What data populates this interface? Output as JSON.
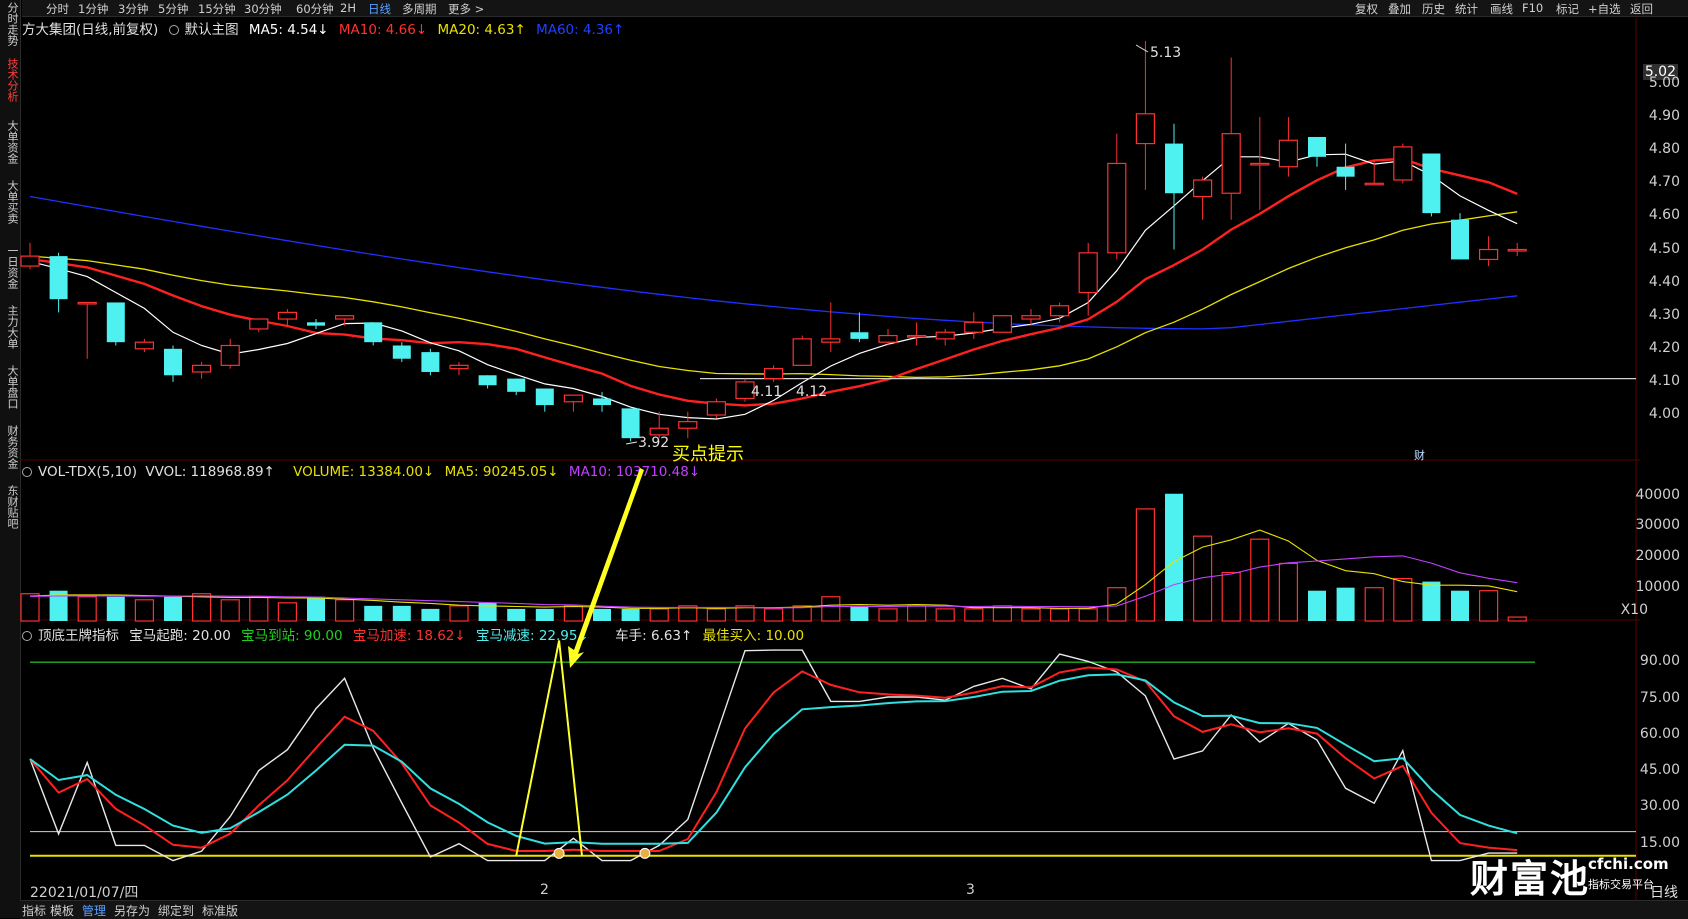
{
  "left_tabs": [
    "分时走势",
    "技术分析",
    "大单资金",
    "大单买卖",
    "一日资金",
    "主力大单",
    "大单盘口",
    "财务资金",
    "东财贴吧"
  ],
  "top_timeframes": [
    "分时",
    "1分钟",
    "3分钟",
    "5分钟",
    "15分钟",
    "30分钟",
    "60分钟",
    "2H",
    "日线",
    "多周期",
    "更多 >"
  ],
  "top_right": [
    "复权",
    "叠加",
    "历史",
    "统计",
    "画线",
    "F10",
    "标记",
    "+自选",
    "返回"
  ],
  "main_header": {
    "title": "方大集团(日线,前复权)",
    "chart_label": "默认主图",
    "ma5": "MA5: 4.54↓",
    "ma10": "MA10: 4.66↓",
    "ma20": "MA20: 4.63↑",
    "ma60": "MA60: 4.36↑"
  },
  "price_axis": [
    "5.02",
    "5.00",
    "4.90",
    "4.80",
    "4.70",
    "4.60",
    "4.50",
    "4.40",
    "4.30",
    "4.20",
    "4.10",
    "4.00"
  ],
  "annotations": {
    "high": "5.13",
    "low": "3.92",
    "mid_left": "4.11",
    "mid_right": "4.12",
    "buy_hint": "买点提示",
    "cai": "财"
  },
  "vol_header": {
    "name": "VOL-TDX(5,10)",
    "vvol": "VVOL: 118968.89↑",
    "volume": "VOLUME: 13384.00↓",
    "ma5": "MA5: 90245.05↓",
    "ma10": "MA10: 103710.48↓"
  },
  "vol_axis": [
    "40000",
    "30000",
    "20000",
    "10000",
    "X10"
  ],
  "ind_header": {
    "name": "顶底王牌指标",
    "start": "宝马起跑: 20.00",
    "arrive": "宝马到站: 90.00",
    "accel": "宝马加速: 18.62↓",
    "decel": "宝马减速: 22.95↓",
    "driver": "车手: 6.63↑",
    "best": "最佳买入: 10.00"
  },
  "ind_axis": [
    "90.00",
    "75.00",
    "60.00",
    "45.00",
    "30.00",
    "15.00"
  ],
  "date_labels": [
    "2021/01/07/四",
    "2",
    "3"
  ],
  "bottom_tabs": [
    "指标",
    "模板",
    "管理",
    "另存为",
    "绑定到",
    "标准版"
  ],
  "watermark": {
    "brand": "财富池",
    "url": "cfchi.com",
    "slogan": "指标交易平台",
    "corner": "日线"
  },
  "colors": {
    "up": "#ff3030",
    "down": "#4ff0f0",
    "ma5": "#ffffff",
    "ma10": "#ff2020",
    "ma20": "#e8e000",
    "ma60": "#2030ff",
    "vol_ma10": "#c040ff",
    "green_line": "#20b020"
  },
  "chart_data": {
    "type": "candlestick",
    "candles_ohlc": [
      [
        4.45,
        4.52,
        4.44,
        4.48
      ],
      [
        4.48,
        4.49,
        4.31,
        4.35
      ],
      [
        4.34,
        4.34,
        4.17,
        4.34
      ],
      [
        4.34,
        4.34,
        4.21,
        4.22
      ],
      [
        4.2,
        4.23,
        4.19,
        4.22
      ],
      [
        4.2,
        4.21,
        4.1,
        4.12
      ],
      [
        4.13,
        4.16,
        4.11,
        4.15
      ],
      [
        4.15,
        4.23,
        4.14,
        4.21
      ],
      [
        4.26,
        4.29,
        4.25,
        4.29
      ],
      [
        4.29,
        4.32,
        4.27,
        4.31
      ],
      [
        4.28,
        4.29,
        4.26,
        4.27
      ],
      [
        4.29,
        4.3,
        4.27,
        4.3
      ],
      [
        4.28,
        4.28,
        4.21,
        4.22
      ],
      [
        4.21,
        4.22,
        4.16,
        4.17
      ],
      [
        4.19,
        4.2,
        4.12,
        4.13
      ],
      [
        4.14,
        4.16,
        4.12,
        4.15
      ],
      [
        4.12,
        4.12,
        4.08,
        4.09
      ],
      [
        4.11,
        4.11,
        4.06,
        4.07
      ],
      [
        4.08,
        4.08,
        4.01,
        4.03
      ],
      [
        4.04,
        4.06,
        4.01,
        4.06
      ],
      [
        4.05,
        4.07,
        4.01,
        4.03
      ],
      [
        4.02,
        4.02,
        3.92,
        3.93
      ],
      [
        3.94,
        4.01,
        3.93,
        3.96
      ],
      [
        3.96,
        4.01,
        3.93,
        3.98
      ],
      [
        4.0,
        4.05,
        3.99,
        4.04
      ],
      [
        4.05,
        4.11,
        4.04,
        4.1
      ],
      [
        4.11,
        4.15,
        4.1,
        4.14
      ],
      [
        4.15,
        4.24,
        4.15,
        4.23
      ],
      [
        4.22,
        4.34,
        4.19,
        4.23
      ],
      [
        4.25,
        4.31,
        4.22,
        4.23
      ],
      [
        4.22,
        4.26,
        4.21,
        4.24
      ],
      [
        4.24,
        4.28,
        4.21,
        4.24
      ],
      [
        4.23,
        4.26,
        4.21,
        4.25
      ],
      [
        4.25,
        4.31,
        4.23,
        4.28
      ],
      [
        4.25,
        4.3,
        4.25,
        4.3
      ],
      [
        4.29,
        4.32,
        4.27,
        4.3
      ],
      [
        4.3,
        4.34,
        4.28,
        4.33
      ],
      [
        4.37,
        4.52,
        4.3,
        4.49
      ],
      [
        4.49,
        4.85,
        4.47,
        4.76
      ],
      [
        4.82,
        5.13,
        4.68,
        4.91
      ],
      [
        4.82,
        4.88,
        4.5,
        4.67
      ],
      [
        4.66,
        4.72,
        4.59,
        4.71
      ],
      [
        4.67,
        5.08,
        4.59,
        4.85
      ],
      [
        4.76,
        4.9,
        4.62,
        4.76
      ],
      [
        4.75,
        4.9,
        4.72,
        4.83
      ],
      [
        4.84,
        4.84,
        4.75,
        4.78
      ],
      [
        4.75,
        4.82,
        4.68,
        4.72
      ],
      [
        4.7,
        4.77,
        4.7,
        4.7
      ],
      [
        4.71,
        4.82,
        4.7,
        4.81
      ],
      [
        4.79,
        4.79,
        4.6,
        4.61
      ],
      [
        4.59,
        4.61,
        4.47,
        4.47
      ],
      [
        4.47,
        4.54,
        4.45,
        4.5
      ],
      [
        4.5,
        4.52,
        4.48,
        4.5
      ]
    ],
    "volume_up_flags": "derived from candles",
    "volume": [
      9,
      10,
      8,
      8,
      7,
      8,
      9,
      7,
      8,
      6,
      8,
      7,
      5,
      5,
      4,
      5,
      6,
      4,
      4,
      5,
      4,
      4,
      4,
      5,
      4,
      5,
      4,
      5,
      8,
      5,
      4,
      5,
      4,
      4,
      5,
      4,
      4,
      4,
      11,
      37,
      42,
      28,
      16,
      27,
      19,
      10,
      11,
      11,
      14,
      13,
      10,
      10,
      1.3
    ],
    "indicator_range": [
      0,
      100
    ],
    "levels": {
      "start": 20,
      "arrive": 90,
      "best": 10
    }
  }
}
